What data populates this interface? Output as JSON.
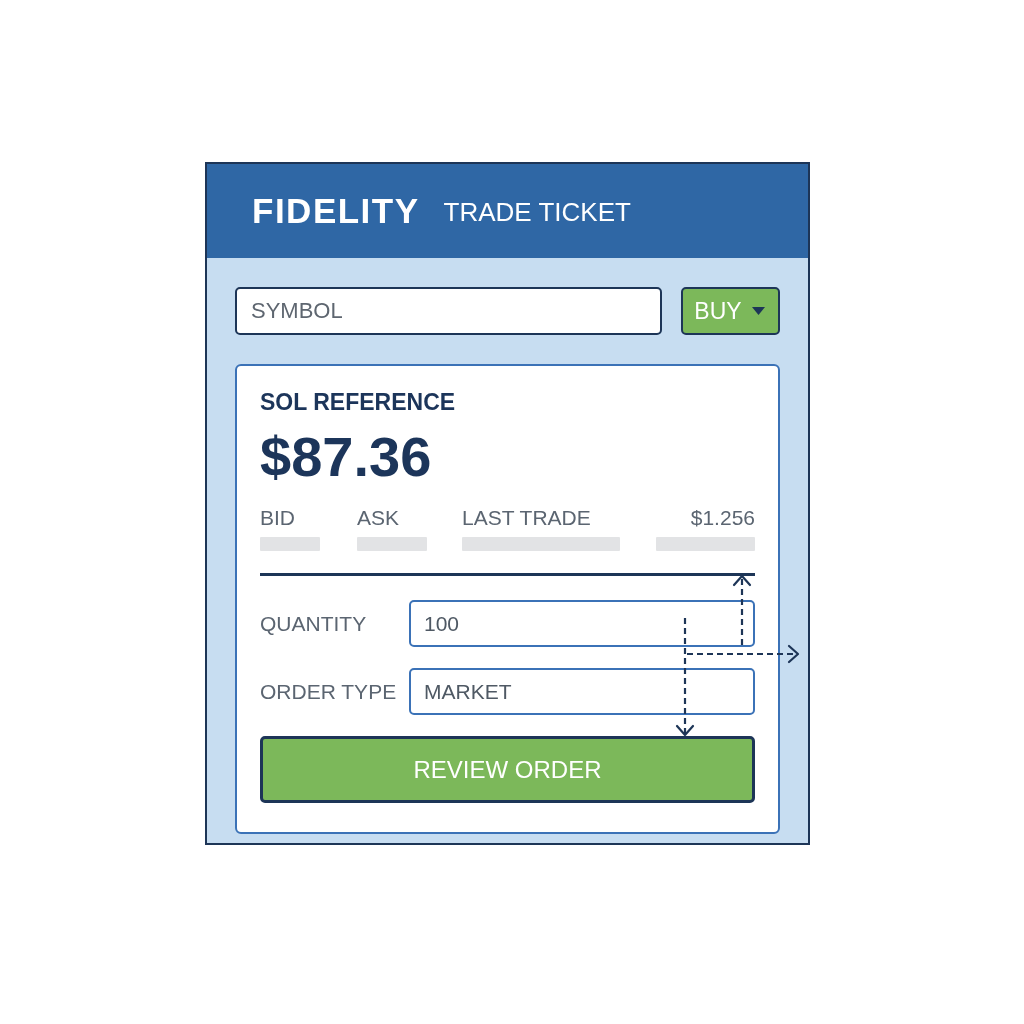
{
  "header": {
    "logo": "FIDELITY",
    "title": "TRADE TICKET"
  },
  "order_bar": {
    "symbol": {
      "placeholder": "SYMBOL"
    },
    "side": {
      "label": "BUY"
    }
  },
  "quote": {
    "title": "SOL REFERENCE",
    "price": "$87.36",
    "columns": [
      {
        "kind": "label",
        "text": "BID"
      },
      {
        "kind": "label",
        "text": "ASK"
      },
      {
        "kind": "label",
        "text": "LAST TRADE"
      },
      {
        "kind": "value",
        "text": "$1.256"
      }
    ]
  },
  "form": {
    "fields": [
      {
        "label": "QUANTITY",
        "value": "100"
      },
      {
        "label": "ORDER TYPE",
        "value": "MARKET"
      }
    ],
    "submit": {
      "label": "REVIEW ORDER"
    }
  }
}
